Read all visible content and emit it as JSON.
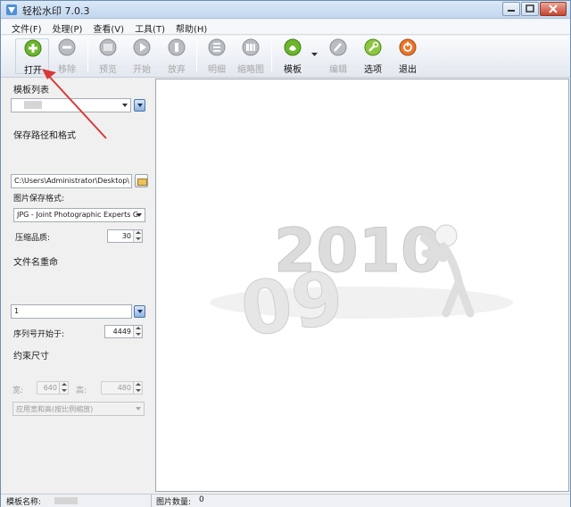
{
  "window": {
    "title": "轻松水印 7.0.3"
  },
  "menu": [
    "文件(F)",
    "处理(P)",
    "查看(V)",
    "工具(T)",
    "帮助(H)"
  ],
  "toolbar": {
    "open": "打开",
    "remove": "移除",
    "preview": "预览",
    "start": "开始",
    "abort": "放弃",
    "details": "明细",
    "thumbnail": "缩略图",
    "template": "模板",
    "edit": "编辑",
    "options": "选项",
    "exit": "退出"
  },
  "left": {
    "template_list_label": "模板列表",
    "save_path_label": "保存路径和格式",
    "save_path_value": "C:\\Users\\Administrator\\Desktop\\",
    "image_format_label": "图片保存格式:",
    "image_format_value": "JPG - Joint Photographic Experts G",
    "quality_label": "压缩品质:",
    "quality_value": "30",
    "rename_label": "文件名重命",
    "rename_value": "1",
    "seq_start_label": "序列号开始于:",
    "seq_start_value": "4449",
    "constrain_label": "约束尺寸",
    "width_label": "宽:",
    "width_value": "640",
    "height_label": "高:",
    "height_value": "480",
    "resize_mode_value": "应用宽和高(按比例缩放)"
  },
  "preview": {
    "year_top": "2010",
    "year_bottom": "09"
  },
  "status": {
    "template_name_label": "模板名称:",
    "image_count_label": "图片数量:",
    "image_count_value": "0"
  },
  "colors": {
    "accent_red": "#d63b3b",
    "title_bg": "#c9dcf1",
    "toolbar_green": "#6cb52d",
    "toolbar_orange": "#e8762b"
  }
}
